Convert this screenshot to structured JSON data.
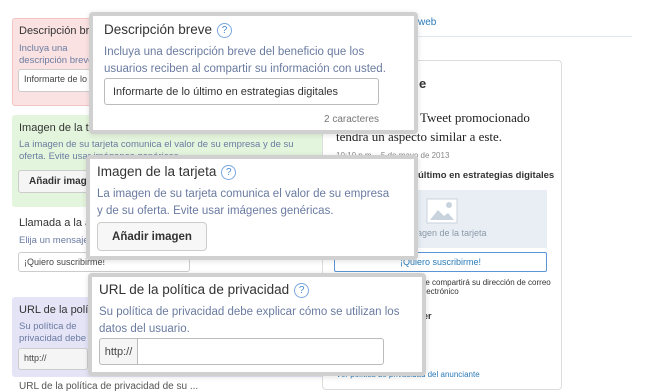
{
  "background": {
    "description_section": {
      "label": "Descripción breve",
      "hint": "Incluya una descripción breve del beneficio que los usuarios reciben al compartir su información con usted.",
      "input_value": "Informarte de lo último en estrategias digitales"
    },
    "image_section": {
      "label": "Imagen de la tarjeta",
      "hint": "La imagen de su tarjeta comunica el valor de su empresa y de su oferta. Evite usar imágenes genéricas.",
      "button_label": "Añadir imagen"
    },
    "cta_section": {
      "label": "Llamada a la acción",
      "hint": "Elija un mensaje que",
      "input_value": "¡Quiero suscribirme!"
    },
    "privacy_section": {
      "label": "URL de la política de privacidad",
      "hint": "Su política de privacidad debe explicar cómo se utilizan los datos del usuario.",
      "prefix": "http://"
    },
    "footer_label": "URL de la política de privacidad de su ...",
    "top_link": "web"
  },
  "preview": {
    "header": "e",
    "tweet_text": "Tweet promocionado tendrá un aspecto similar a este.",
    "timestamp": "10:10 p.m. - 5 de mayo de 2013",
    "card_title": "último en estrategias digitales",
    "image_placeholder": "Imagen de la tarjeta",
    "cta_button": "¡Quiero suscribirme!",
    "email_note": "Se compartirá su dirección de correo electrónico",
    "twitter_label": "ter",
    "handle_label": "n",
    "privacy_link": "Ver política de privacidad del anunciante"
  },
  "popups": {
    "description": {
      "title": "Descripción breve",
      "help": "?",
      "desc": "Incluya una descripción breve del beneficio que los usuarios reciben al compartir su información con usted.",
      "input_value": "Informarte de lo último en estrategias digitales",
      "counter": "2 caracteres"
    },
    "image": {
      "title": "Imagen de la tarjeta",
      "help": "?",
      "desc": "La imagen de su tarjeta comunica el valor de su empresa y de su oferta. Evite usar imágenes genéricas.",
      "button_label": "Añadir imagen"
    },
    "privacy": {
      "title": "URL de la política de privacidad",
      "help": "?",
      "desc": "Su política de privacidad debe explicar cómo se utilizan los datos del usuario.",
      "prefix": "http://",
      "input_value": ""
    }
  },
  "colors": {
    "error_bg": "#fbe2e2",
    "success_bg": "#e4f5dd",
    "info_bg": "#e5e4f7",
    "link": "#2b7bb9",
    "help_icon": "#4a8ad4"
  }
}
